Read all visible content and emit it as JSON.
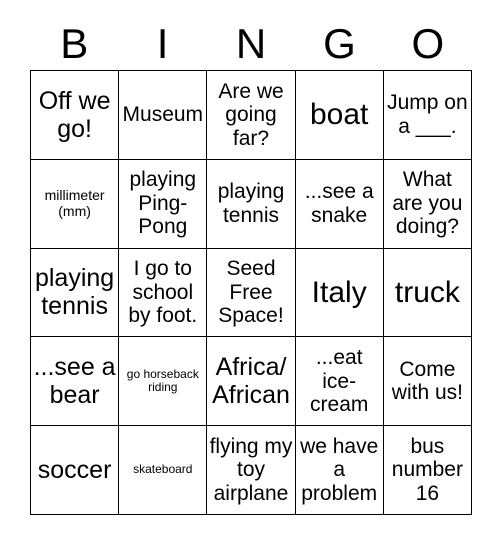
{
  "card": {
    "title": "BINGO card",
    "header_letters": [
      "B",
      "I",
      "N",
      "G",
      "O"
    ],
    "columns": 5,
    "rows": 5,
    "free_space_index": 12,
    "colors": {
      "background": "#ffffff",
      "text": "#000000",
      "border": "#000000"
    },
    "cells": [
      {
        "text": "Off we go!",
        "size": "lg"
      },
      {
        "text": "Museum",
        "size": "md"
      },
      {
        "text": "Are we going far?",
        "size": "md"
      },
      {
        "text": "boat",
        "size": "xl"
      },
      {
        "text": "Jump on a ___.",
        "size": "md"
      },
      {
        "text": "millimeter (mm)",
        "size": "xs"
      },
      {
        "text": "playing Ping-Pong",
        "size": "md"
      },
      {
        "text": "playing tennis",
        "size": "md"
      },
      {
        "text": "...see a snake",
        "size": "md"
      },
      {
        "text": "What are you doing?",
        "size": "md"
      },
      {
        "text": "playing tennis",
        "size": "lg"
      },
      {
        "text": "I go to school by foot.",
        "size": "md"
      },
      {
        "text": "Seed Free Space!",
        "size": "md"
      },
      {
        "text": "Italy",
        "size": "xl"
      },
      {
        "text": "truck",
        "size": "xl"
      },
      {
        "text": "...see a bear",
        "size": "lg"
      },
      {
        "text": "go horseback riding",
        "size": "xxs"
      },
      {
        "text": "Africa/ African",
        "size": "lg"
      },
      {
        "text": "...eat ice-cream",
        "size": "md"
      },
      {
        "text": "Come with us!",
        "size": "md"
      },
      {
        "text": "soccer",
        "size": "lg"
      },
      {
        "text": "skateboard",
        "size": "xxs"
      },
      {
        "text": "flying my toy airplane",
        "size": "md"
      },
      {
        "text": "we have a problem",
        "size": "md"
      },
      {
        "text": "bus number 16",
        "size": "md"
      }
    ]
  }
}
